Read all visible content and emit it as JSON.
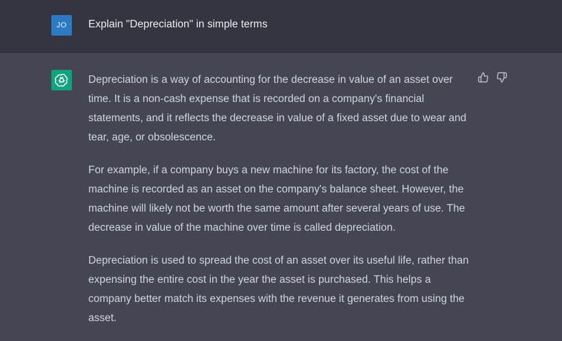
{
  "user": {
    "avatar_initials": "JO",
    "avatar_color": "#2a7bc2",
    "prompt": "Explain \"Depreciation\" in simple terms"
  },
  "assistant": {
    "avatar_icon": "openai-logo-icon",
    "avatar_color": "#10a37f",
    "paragraphs": [
      "Depreciation is a way of accounting for the decrease in value of an asset over time. It is a non-cash expense that is recorded on a company's financial statements, and it reflects the decrease in value of a fixed asset due to wear and tear, age, or obsolescence.",
      "For example, if a company buys a new machine for its factory, the cost of the machine is recorded as an asset on the company's balance sheet. However, the machine will likely not be worth the same amount after several years of use. The decrease in value of the machine over time is called depreciation.",
      "Depreciation is used to spread the cost of an asset over its useful life, rather than expensing the entire cost in the year the asset is purchased. This helps a company better match its expenses with the revenue it generates from using the asset."
    ],
    "feedback_icons": [
      "thumbs-up-icon",
      "thumbs-down-icon"
    ]
  },
  "colors": {
    "user_row_bg": "#343541",
    "assistant_row_bg": "#444654",
    "text": "#d1d5db"
  }
}
